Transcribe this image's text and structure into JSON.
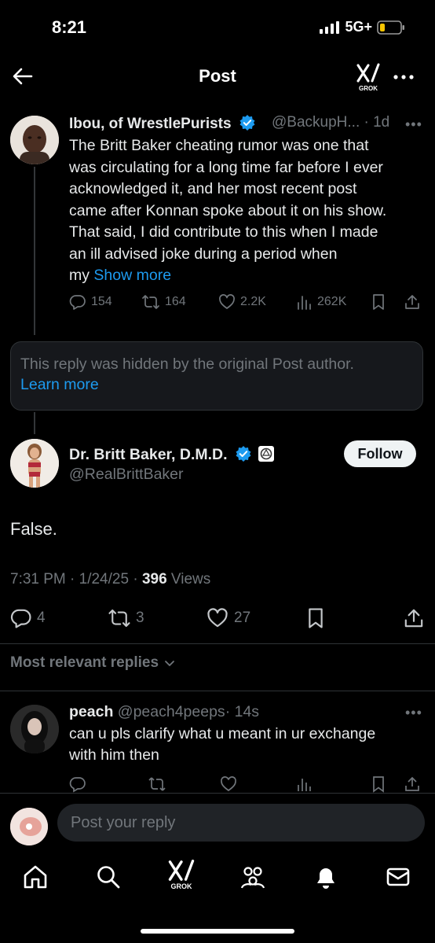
{
  "status": {
    "time": "8:21",
    "network": "5G+"
  },
  "header": {
    "title": "Post",
    "grok_label": "GROK"
  },
  "parent_tweet": {
    "author_name": "Ibou, of WrestlePurists",
    "handle": "@BackupH...",
    "age": "· 1d",
    "lines": [
      "The Britt Baker cheating rumor was one that",
      "was circulating for a long time far before I ever",
      "acknowledged it, and her most recent post",
      "came after Konnan spoke about it on his show.",
      "That said, I did contribute to this when I made",
      "an ill advised joke during a period when"
    ],
    "last_line_prefix": "my",
    "show_more": "Show more",
    "replies": "154",
    "reposts": "164",
    "likes": "2.2K",
    "views": "262K"
  },
  "hidden_reply": {
    "text": "This reply was hidden by the original Post author.",
    "link": "Learn more"
  },
  "main_tweet": {
    "author_name": "Dr. Britt Baker, D.M.D.",
    "handle": "@RealBrittBaker",
    "follow_label": "Follow",
    "text": "False.",
    "time": "7:31 PM · 1/24/25 ·",
    "views_count": "396",
    "views_label": "Views",
    "replies": "4",
    "reposts": "3",
    "likes": "27"
  },
  "replies_section": {
    "label": "Most relevant replies"
  },
  "reply": {
    "author_name": "peach",
    "handle": "@peach4peeps",
    "age": "· 14s",
    "lines": [
      "can u pls clarify what u meant in ur exchange",
      "with him then"
    ]
  },
  "composer": {
    "placeholder": "Post your reply"
  },
  "tabbar": {
    "grok_label": "GROK"
  },
  "colors": {
    "accent": "#1d9bf0",
    "text": "#e7e9ea",
    "muted": "#71767b",
    "background": "#000000"
  }
}
